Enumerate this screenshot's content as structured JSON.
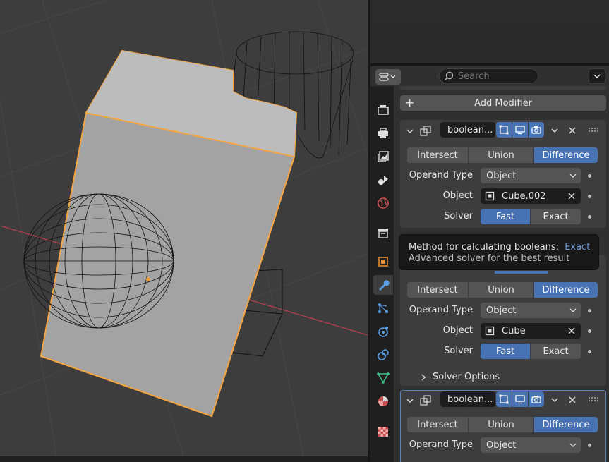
{
  "header": {
    "search_placeholder": "Search"
  },
  "add_modifier_label": "Add Modifier",
  "operation_labels": {
    "intersect": "Intersect",
    "union": "Union",
    "difference": "Difference"
  },
  "row_labels": {
    "operand_type": "Operand Type",
    "object": "Object",
    "solver": "Solver"
  },
  "solver_labels": {
    "fast": "Fast",
    "exact": "Exact"
  },
  "modifiers": [
    {
      "name": "boolean...",
      "operation": "Difference",
      "operand_type": "Object",
      "object": "Cube.002",
      "solver": "Fast"
    },
    {
      "name": "boolean...",
      "operation": "Difference",
      "operand_type": "Object",
      "object": "Cube",
      "solver": "Fast",
      "solver_options": "Solver Options"
    },
    {
      "name": "boolean...",
      "operation": "Difference",
      "operand_type": "Object"
    }
  ],
  "tooltip": {
    "title": "Method for calculating booleans:",
    "value": "Exact",
    "description": "Advanced solver for the best result"
  },
  "tabs": [
    "tool-icon",
    "render-icon",
    "output-icon",
    "view-layer-icon",
    "scene-icon",
    "world-icon",
    "collection-icon",
    "object-icon",
    "modifier-icon",
    "particles-icon",
    "physics-icon",
    "constraints-icon",
    "data-icon",
    "material-icon",
    "texture-icon"
  ],
  "colors": {
    "accent": "#4772b3",
    "selection_outline": "#f5a442",
    "x_axis": "#c04050"
  }
}
